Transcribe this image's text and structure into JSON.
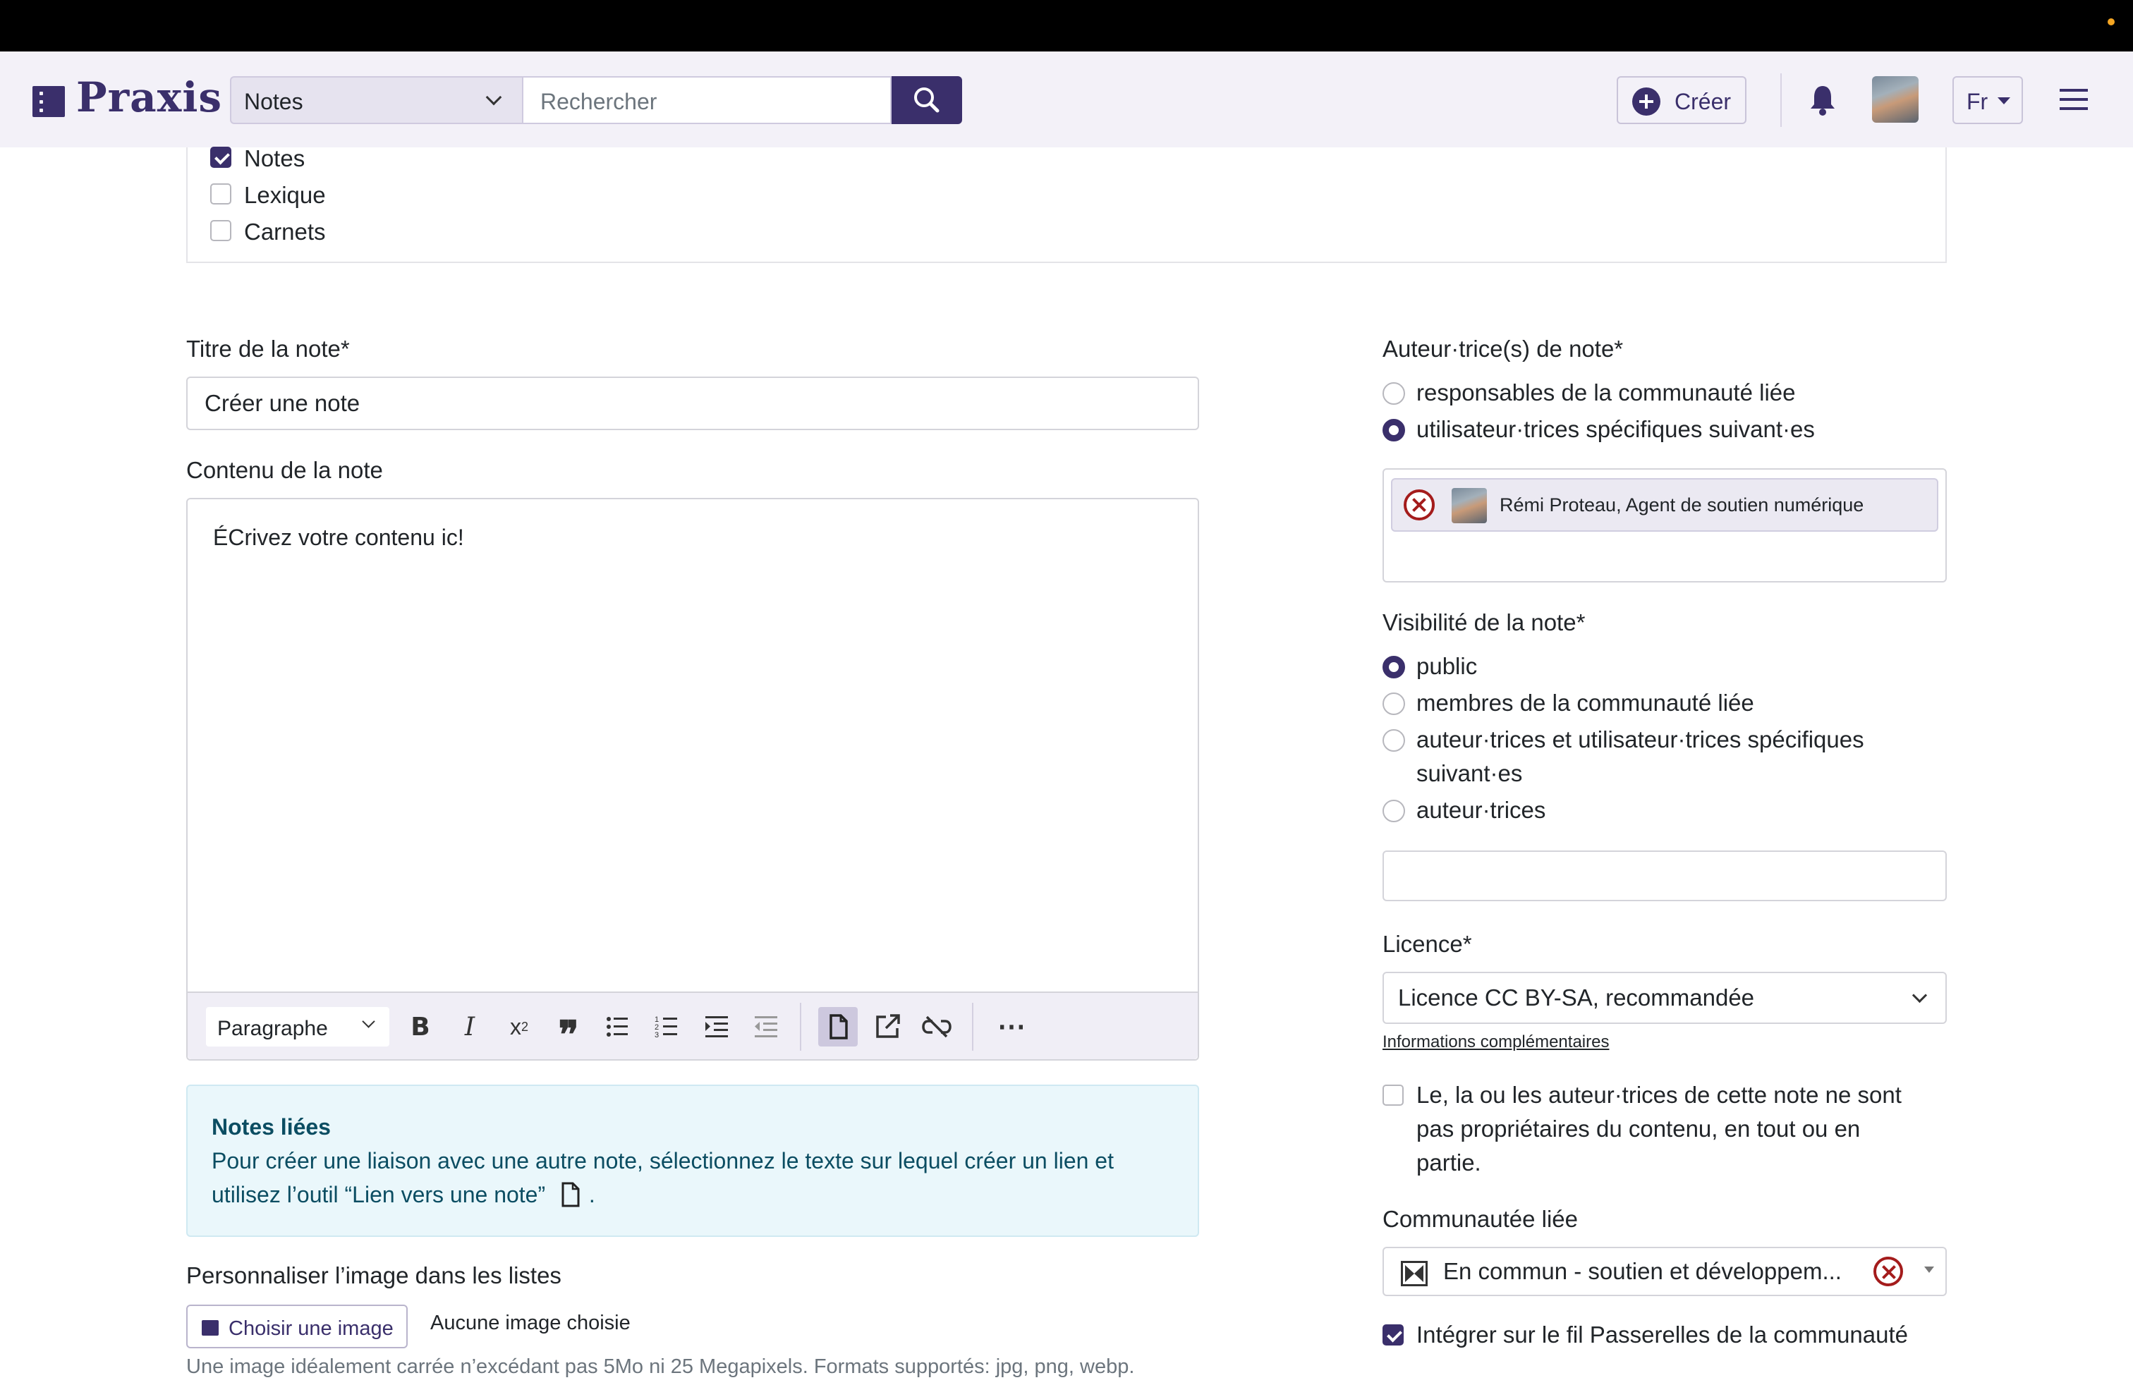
{
  "header": {
    "logo": "Praxis",
    "scope_select": "Notes",
    "search_placeholder": "Rechercher",
    "create_label": "Créer",
    "lang": "Fr"
  },
  "filters": [
    {
      "label": "Notes",
      "checked": true
    },
    {
      "label": "Lexique",
      "checked": false
    },
    {
      "label": "Carnets",
      "checked": false
    }
  ],
  "form": {
    "title_label": "Titre de la note*",
    "title_value": "Créer une note",
    "content_label": "Contenu de la note",
    "content_value": "ÉCrivez votre contenu ic!",
    "toolbar_block_format": "Paragraphe",
    "linked_notes_title": "Notes liées",
    "linked_notes_text": "Pour créer une liaison avec une autre note, sélectionnez le texte sur lequel créer un lien et utilisez l’outil “Lien vers une note”",
    "linked_notes_end": ".",
    "image_label": "Personnaliser l’image dans les listes",
    "choose_image": "Choisir une image",
    "no_image": "Aucune image choisie",
    "image_hint": "Une image idéalement carrée n’excédant pas 5Mo ni 25 Megapixels. Formats supportés: jpg, png, webp."
  },
  "authors": {
    "label": "Auteur·trice(s) de note*",
    "options": [
      "responsables de la communauté liée",
      "utilisateur·trices spécifiques suivant·es"
    ],
    "selected_index": 1,
    "chip": "Rémi Proteau, Agent de soutien numérique"
  },
  "visibility": {
    "label": "Visibilité de la note*",
    "options": [
      "public",
      "membres de la communauté liée",
      "auteur·trices et utilisateur·trices spécifiques",
      "suivant·es",
      "auteur·trices"
    ],
    "selected_index": 0
  },
  "licence": {
    "label": "Licence*",
    "value": "Licence CC BY-SA, recommandée",
    "more_info": "Informations complémentaires",
    "not_owner_line1": "Le, la ou les auteur·trices de cette note ne sont",
    "not_owner_line2": "pas propriétaires du contenu, en tout ou en",
    "not_owner_line3": "partie."
  },
  "community": {
    "label": "Communautée liée",
    "value": "En commun - soutien et développem...",
    "integrate_label": "Intégrer sur le fil Passerelles de la communauté",
    "integrate_checked": true
  },
  "colors": {
    "brand": "#3a2f6b",
    "header_bg": "#f3f1f8",
    "info_bg": "#eaf7fb",
    "error": "#a41c1c"
  }
}
